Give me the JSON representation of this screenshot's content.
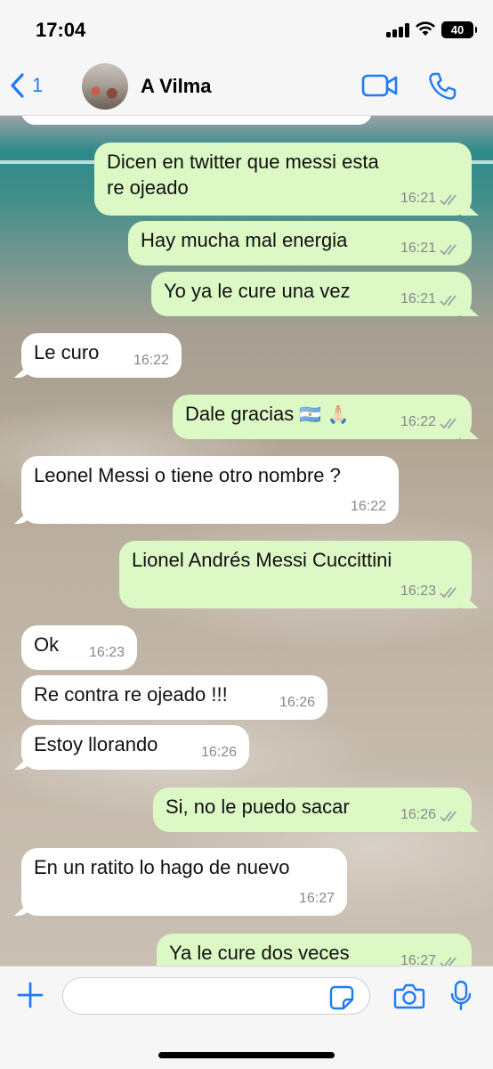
{
  "status_bar": {
    "time": "17:04",
    "battery": "40"
  },
  "header": {
    "back_count": "1",
    "contact_name": "A Vilma"
  },
  "colors": {
    "accent": "#1f7bf5",
    "outgoing_bubble": "#dbf8c5",
    "incoming_bubble": "#ffffff",
    "read_ticks": "#9aa0a6"
  },
  "messages": [
    {
      "direction": "out",
      "text": "Dicen en twitter que messi esta re ojeado",
      "time": "16:21",
      "status": "read"
    },
    {
      "direction": "out",
      "text": "Hay mucha mal energia",
      "time": "16:21",
      "status": "read"
    },
    {
      "direction": "out",
      "text": "Yo ya le cure una vez",
      "time": "16:21",
      "status": "read"
    },
    {
      "direction": "in",
      "text": "Le curo",
      "time": "16:22"
    },
    {
      "direction": "out",
      "text": "Dale gracias",
      "emoji": "🇦🇷 🙏🏻",
      "time": "16:22",
      "status": "read"
    },
    {
      "direction": "in",
      "text": "Leonel Messi o tiene otro nombre ?",
      "time": "16:22"
    },
    {
      "direction": "out",
      "text": "Lionel Andrés Messi Cuccittini",
      "time": "16:23",
      "status": "read"
    },
    {
      "direction": "in",
      "text": "Ok",
      "time": "16:23"
    },
    {
      "direction": "in",
      "text": "Re contra re ojeado !!!",
      "time": "16:26"
    },
    {
      "direction": "in",
      "text": "Estoy llorando",
      "time": "16:26"
    },
    {
      "direction": "out",
      "text": "Si, no le puedo sacar",
      "time": "16:26",
      "status": "read"
    },
    {
      "direction": "in",
      "text": "En un ratito lo hago de nuevo",
      "time": "16:27"
    },
    {
      "direction": "out",
      "text": "Ya le cure dos veces",
      "time": "16:27",
      "status": "read"
    }
  ],
  "input": {
    "placeholder": ""
  },
  "icons": {
    "back": "chevron-left-icon",
    "video": "video-camera-icon",
    "call": "phone-icon",
    "attach": "plus-icon",
    "sticker": "sticker-icon",
    "camera": "camera-icon",
    "mic": "microphone-icon"
  }
}
